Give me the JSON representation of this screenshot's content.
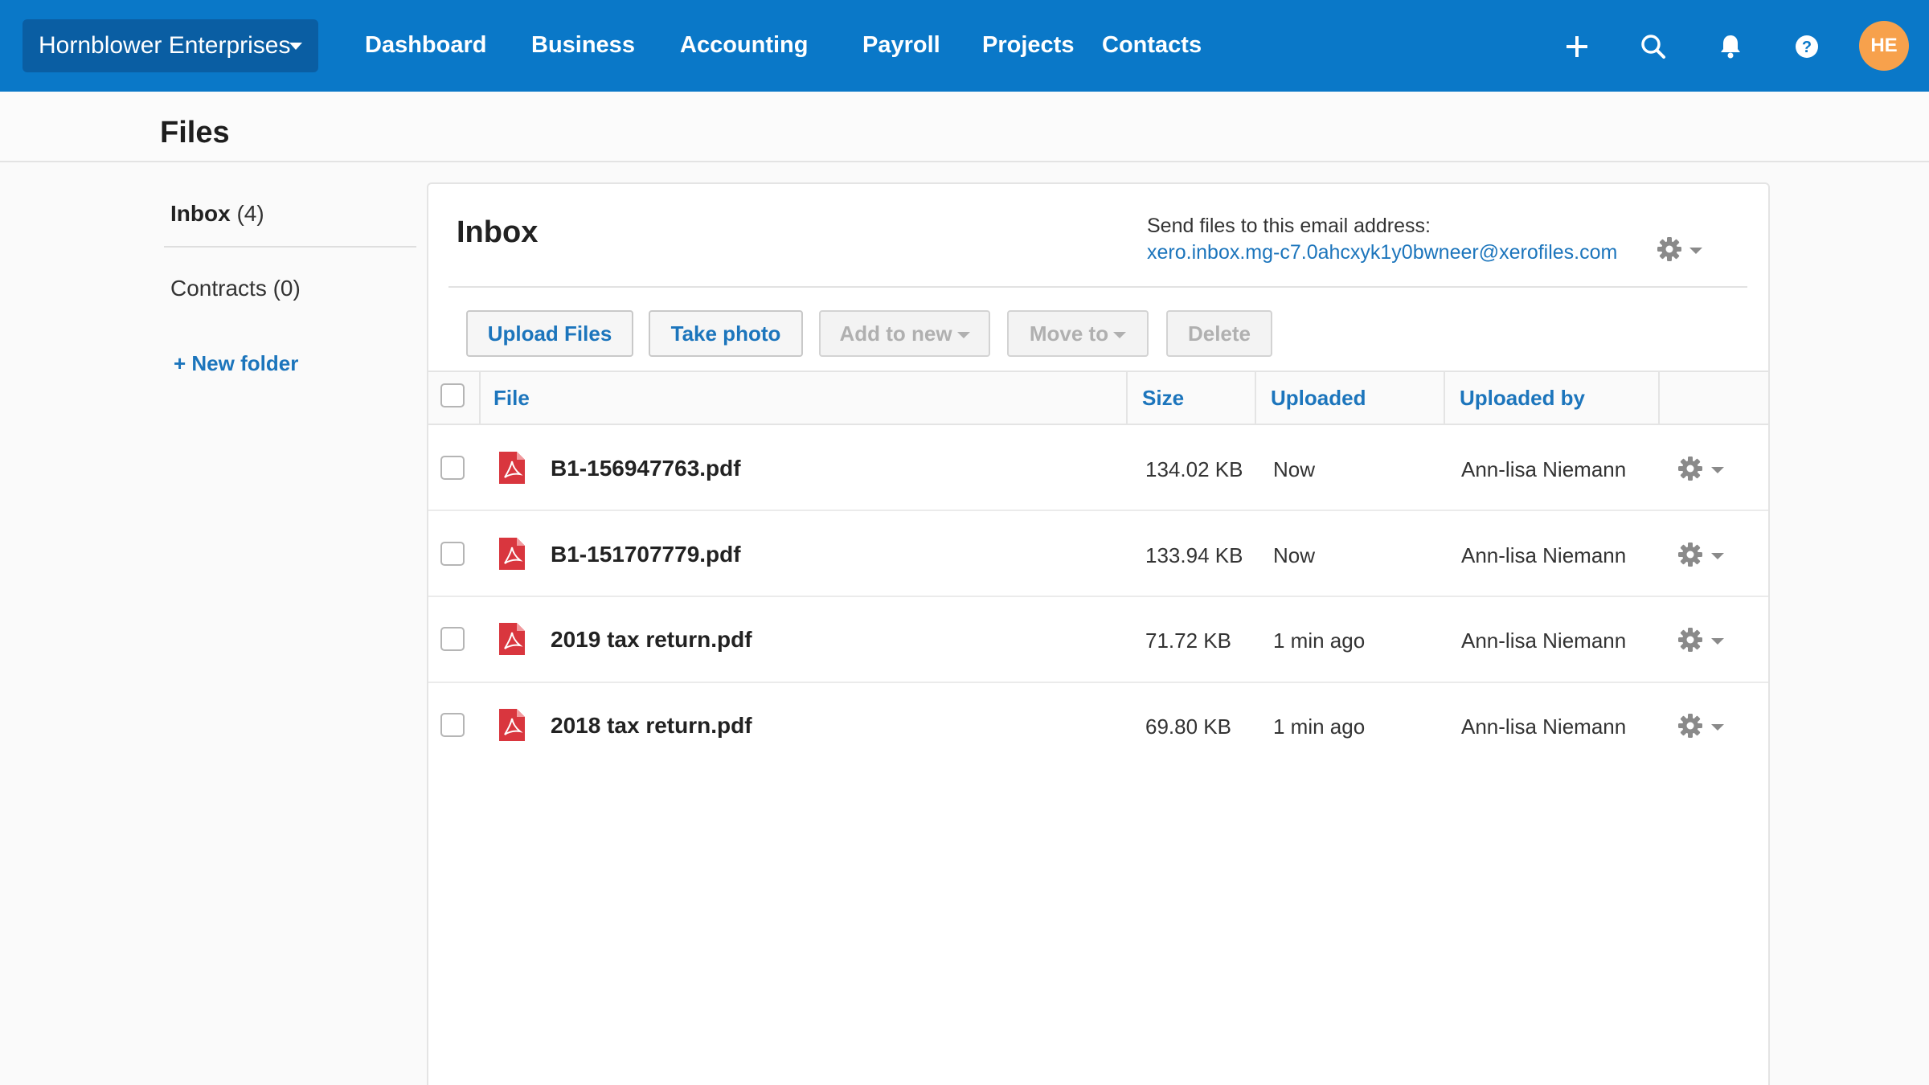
{
  "topbar": {
    "org_name": "Hornblower Enterprises",
    "nav": [
      "Dashboard",
      "Business",
      "Accounting",
      "Payroll",
      "Projects",
      "Contacts"
    ],
    "icons": [
      "plus-icon",
      "search-icon",
      "bell-icon",
      "help-icon"
    ],
    "avatar": "HE",
    "colors": {
      "bar": "#0a78c8",
      "org": "#0a5ea3",
      "avatar": "#f7a14c"
    }
  },
  "page": {
    "title": "Files"
  },
  "sidebar": {
    "folders": [
      {
        "name": "Inbox",
        "count": "(4)"
      },
      {
        "name": "Contracts",
        "count": "(0)"
      }
    ],
    "new_folder": "+ New folder"
  },
  "inbox": {
    "title": "Inbox",
    "send_label": "Send files to this email address:",
    "email": "xero.inbox.mg-c7.0ahcxyk1y0bwneer@xerofiles.com",
    "buttons": {
      "upload": "Upload Files",
      "photo": "Take photo",
      "add_new": "Add to new",
      "move_to": "Move to",
      "delete": "Delete"
    },
    "columns": [
      "File",
      "Size",
      "Uploaded",
      "Uploaded by"
    ],
    "rows": [
      {
        "file": "B1-156947763.pdf",
        "size": "134.02 KB",
        "uploaded": "Now",
        "by": "Ann-lisa Niemann"
      },
      {
        "file": "B1-151707779.pdf",
        "size": "133.94 KB",
        "uploaded": "Now",
        "by": "Ann-lisa Niemann"
      },
      {
        "file": "2019 tax return.pdf",
        "size": "71.72 KB",
        "uploaded": "1 min ago",
        "by": "Ann-lisa Niemann"
      },
      {
        "file": "2018 tax return.pdf",
        "size": "69.80 KB",
        "uploaded": "1 min ago",
        "by": "Ann-lisa Niemann"
      }
    ],
    "colors": {
      "link": "#1c75bc",
      "pdf": "#d9363e"
    }
  }
}
